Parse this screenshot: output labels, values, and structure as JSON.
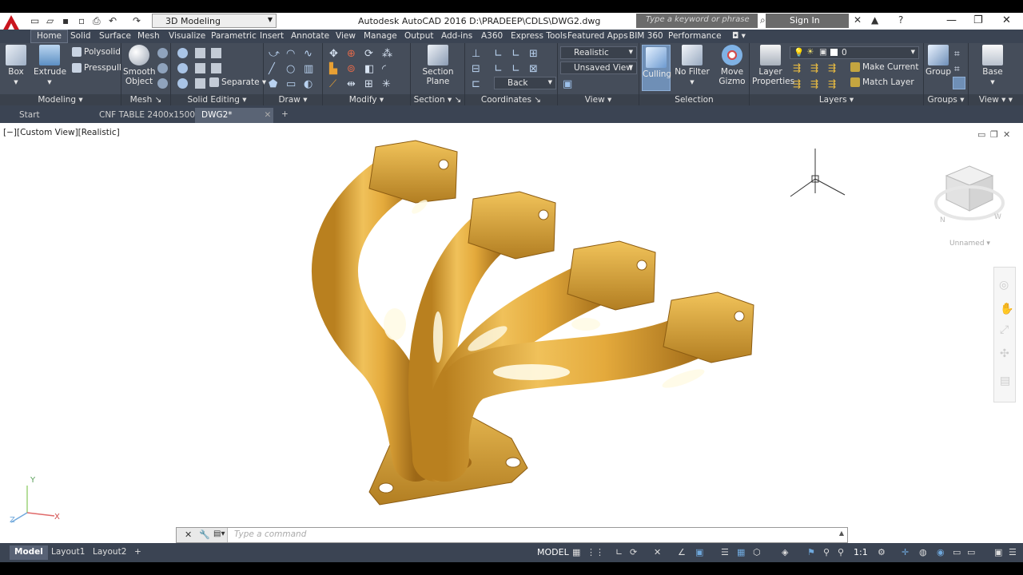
{
  "app": {
    "title": "Autodesk AutoCAD 2016    D:\\PRADEEP\\CDLS\\DWG2.dwg",
    "logo": "A",
    "workspace": "3D Modeling",
    "search_placeholder": "Type a keyword or phrase",
    "signin": "Sign In"
  },
  "ribbon_tabs": [
    "Home",
    "Solid",
    "Surface",
    "Mesh",
    "Visualize",
    "Parametric",
    "Insert",
    "Annotate",
    "View",
    "Manage",
    "Output",
    "Add-ins",
    "A360",
    "Express Tools",
    "Featured Apps",
    "BIM 360",
    "Performance"
  ],
  "ribbon": {
    "modeling": {
      "label": "Modeling",
      "box": "Box",
      "extrude": "Extrude",
      "polysolid": "Polysolid",
      "presspull": "Presspull"
    },
    "mesh": {
      "label": "Mesh",
      "smooth_object": "Smooth\nObject"
    },
    "solid_editing": {
      "label": "Solid Editing",
      "separate": "Separate"
    },
    "draw": {
      "label": "Draw"
    },
    "modify": {
      "label": "Modify"
    },
    "section": {
      "label": "Section",
      "section_plane": "Section\nPlane"
    },
    "coordinates": {
      "label": "Coordinates"
    },
    "view": {
      "label": "View",
      "visual_style": "Realistic",
      "saved_view": "Unsaved View",
      "view_direction": "Back"
    },
    "selection": {
      "label": "Selection",
      "culling": "Culling",
      "no_filter": "No Filter",
      "move_gizmo": "Move\nGizmo"
    },
    "layers": {
      "label": "Layers",
      "layer_properties": "Layer\nProperties",
      "current_layer": "0",
      "make_current": "Make Current",
      "match_layer": "Match Layer"
    },
    "groups": {
      "label": "Groups",
      "group": "Group"
    },
    "view2": {
      "label": "View",
      "base": "Base"
    }
  },
  "doc_tabs": [
    {
      "label": "Start"
    },
    {
      "label": "CNF TABLE 2400x1500*"
    },
    {
      "label": "DWG2*"
    }
  ],
  "viewport": {
    "label": "[−][Custom View][Realistic]",
    "viewcube_label": "Unnamed",
    "model_color": "#e3a83a",
    "ucs": {
      "x": "X",
      "y": "Y",
      "z": "Z"
    }
  },
  "cmdline": {
    "placeholder": "Type  a  command"
  },
  "status": {
    "tabs": [
      "Model",
      "Layout1",
      "Layout2"
    ],
    "model_label": "MODEL",
    "scale": "1:1"
  }
}
